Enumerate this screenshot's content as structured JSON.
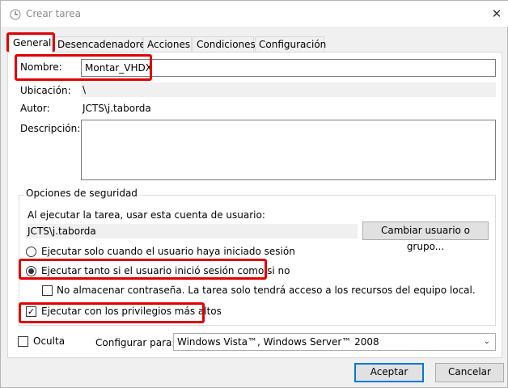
{
  "window": {
    "title": "Crear tarea"
  },
  "tabs": [
    {
      "label": "General"
    },
    {
      "label": "Desencadenadores"
    },
    {
      "label": "Acciones"
    },
    {
      "label": "Condiciones"
    },
    {
      "label": "Configuración"
    }
  ],
  "general": {
    "name_label": "Nombre:",
    "name_value": "Montar_VHDX",
    "location_label": "Ubicación:",
    "location_value": "\\",
    "author_label": "Autor:",
    "author_value": "JCTS\\j.taborda",
    "description_label": "Descripción:",
    "description_value": ""
  },
  "security": {
    "group_title": "Opciones de seguridad",
    "run_as_text": "Al ejecutar la tarea, usar esta cuenta de usuario:",
    "user_account": "JCTS\\j.taborda",
    "change_user_button": "Cambiar usuario o grupo...",
    "radio_logged_on": "Ejecutar solo cuando el usuario haya iniciado sesión",
    "radio_logged_on_or_not": "Ejecutar tanto si el usuario inició sesión como si no",
    "no_store_password": "No almacenar contraseña. La tarea solo tendrá acceso a los recursos del equipo local.",
    "highest_privileges": "Ejecutar con los privilegios más altos"
  },
  "footer": {
    "hidden_label": "Oculta",
    "configure_for_label": "Configurar para:",
    "configure_for_value": "Windows Vista™, Windows Server™ 2008",
    "ok_button": "Aceptar",
    "cancel_button": "Cancelar"
  },
  "state": {
    "selected_tab": "General",
    "radio_selected": "logged_on_or_not",
    "no_store_password_checked": false,
    "highest_privileges_checked": true,
    "hidden_checked": false
  },
  "colors": {
    "highlight": "#e00000",
    "accent": "#0078d7"
  }
}
